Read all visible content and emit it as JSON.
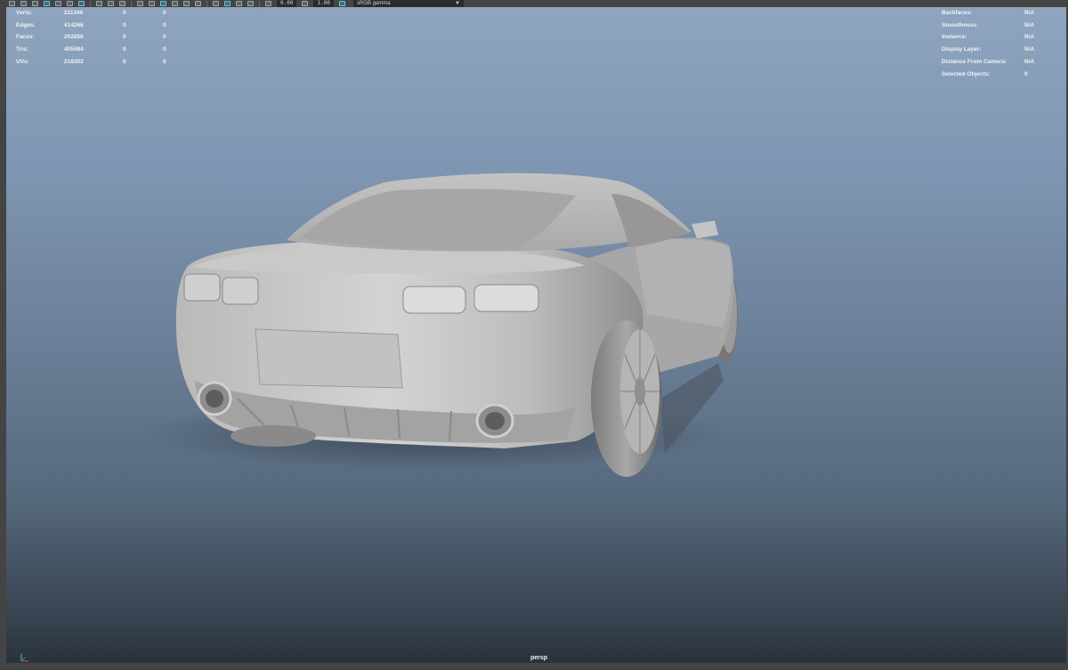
{
  "toolbar": {
    "field1_value": "0.00",
    "field2_value": "1.00",
    "color_space": "sRGB gamma"
  },
  "hud_left": {
    "rows": [
      {
        "label": "Verts:",
        "v1": "211340",
        "v2": "0",
        "v3": "0"
      },
      {
        "label": "Edges:",
        "v1": "414266",
        "v2": "0",
        "v3": "0"
      },
      {
        "label": "Faces:",
        "v1": "202856",
        "v2": "0",
        "v3": "0"
      },
      {
        "label": "Tris:",
        "v1": "405584",
        "v2": "0",
        "v3": "0"
      },
      {
        "label": "UVs:",
        "v1": "218302",
        "v2": "0",
        "v3": "0"
      }
    ]
  },
  "hud_right": {
    "rows": [
      {
        "label": "Backfaces:",
        "value": "N/A"
      },
      {
        "label": "Smoothness:",
        "value": "N/A"
      },
      {
        "label": "Instance:",
        "value": "N/A"
      },
      {
        "label": "Display Layer:",
        "value": "N/A"
      },
      {
        "label": "Distance From Camera:",
        "value": "N/A"
      },
      {
        "label": "Selected Objects:",
        "value": "0"
      }
    ]
  },
  "viewport": {
    "camera_label": "persp",
    "background_top": "#8ea4bf",
    "background_bottom": "#2a323b"
  },
  "icons": [
    "select-tool-icon",
    "lasso-tool-icon",
    "paint-select-icon",
    "move-icon",
    "rotate-icon",
    "scale-icon",
    "camera-icon",
    "grid-icon",
    "wireframe-icon",
    "smooth-shade-icon",
    "textured-icon",
    "lighting-icon",
    "shadow-icon",
    "ambient-occlusion-icon",
    "motion-blur-icon",
    "anti-alias-icon",
    "isolate-select-icon",
    "xray-icon",
    "exposure-icon",
    "gamma-icon",
    "dropdown-arrow-icon"
  ]
}
